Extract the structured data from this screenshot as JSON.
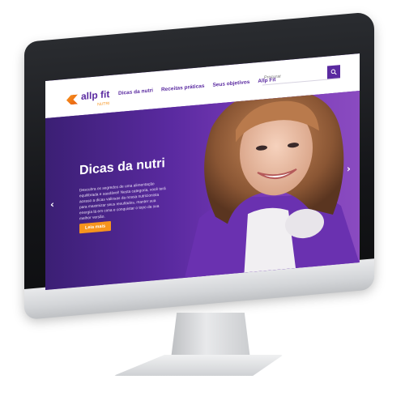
{
  "brand": {
    "name": "allp fit",
    "tagline": "NUTRI"
  },
  "nav": {
    "items": [
      {
        "label": "Dicas da nutri"
      },
      {
        "label": "Receitas práticas"
      },
      {
        "label": "Seus objetivos"
      },
      {
        "label": "Allp Fit"
      }
    ]
  },
  "search": {
    "placeholder": "Procurar"
  },
  "hero": {
    "title": "Dicas da nutri",
    "description": "Descubra os segredos de uma alimentação equilibrada e saudável! Nesta categoria, você terá acesso a dicas valiosas da nossa nutricionista para maximizar seus resultados, manter sua energia lá em cima e conquistar o topo da sua melhor versão.",
    "button_label": "Leia mais",
    "prev_arrow": "‹",
    "next_arrow": "›"
  },
  "colors": {
    "brand_purple": "#5a2aa0",
    "accent_orange": "#f7941d"
  }
}
